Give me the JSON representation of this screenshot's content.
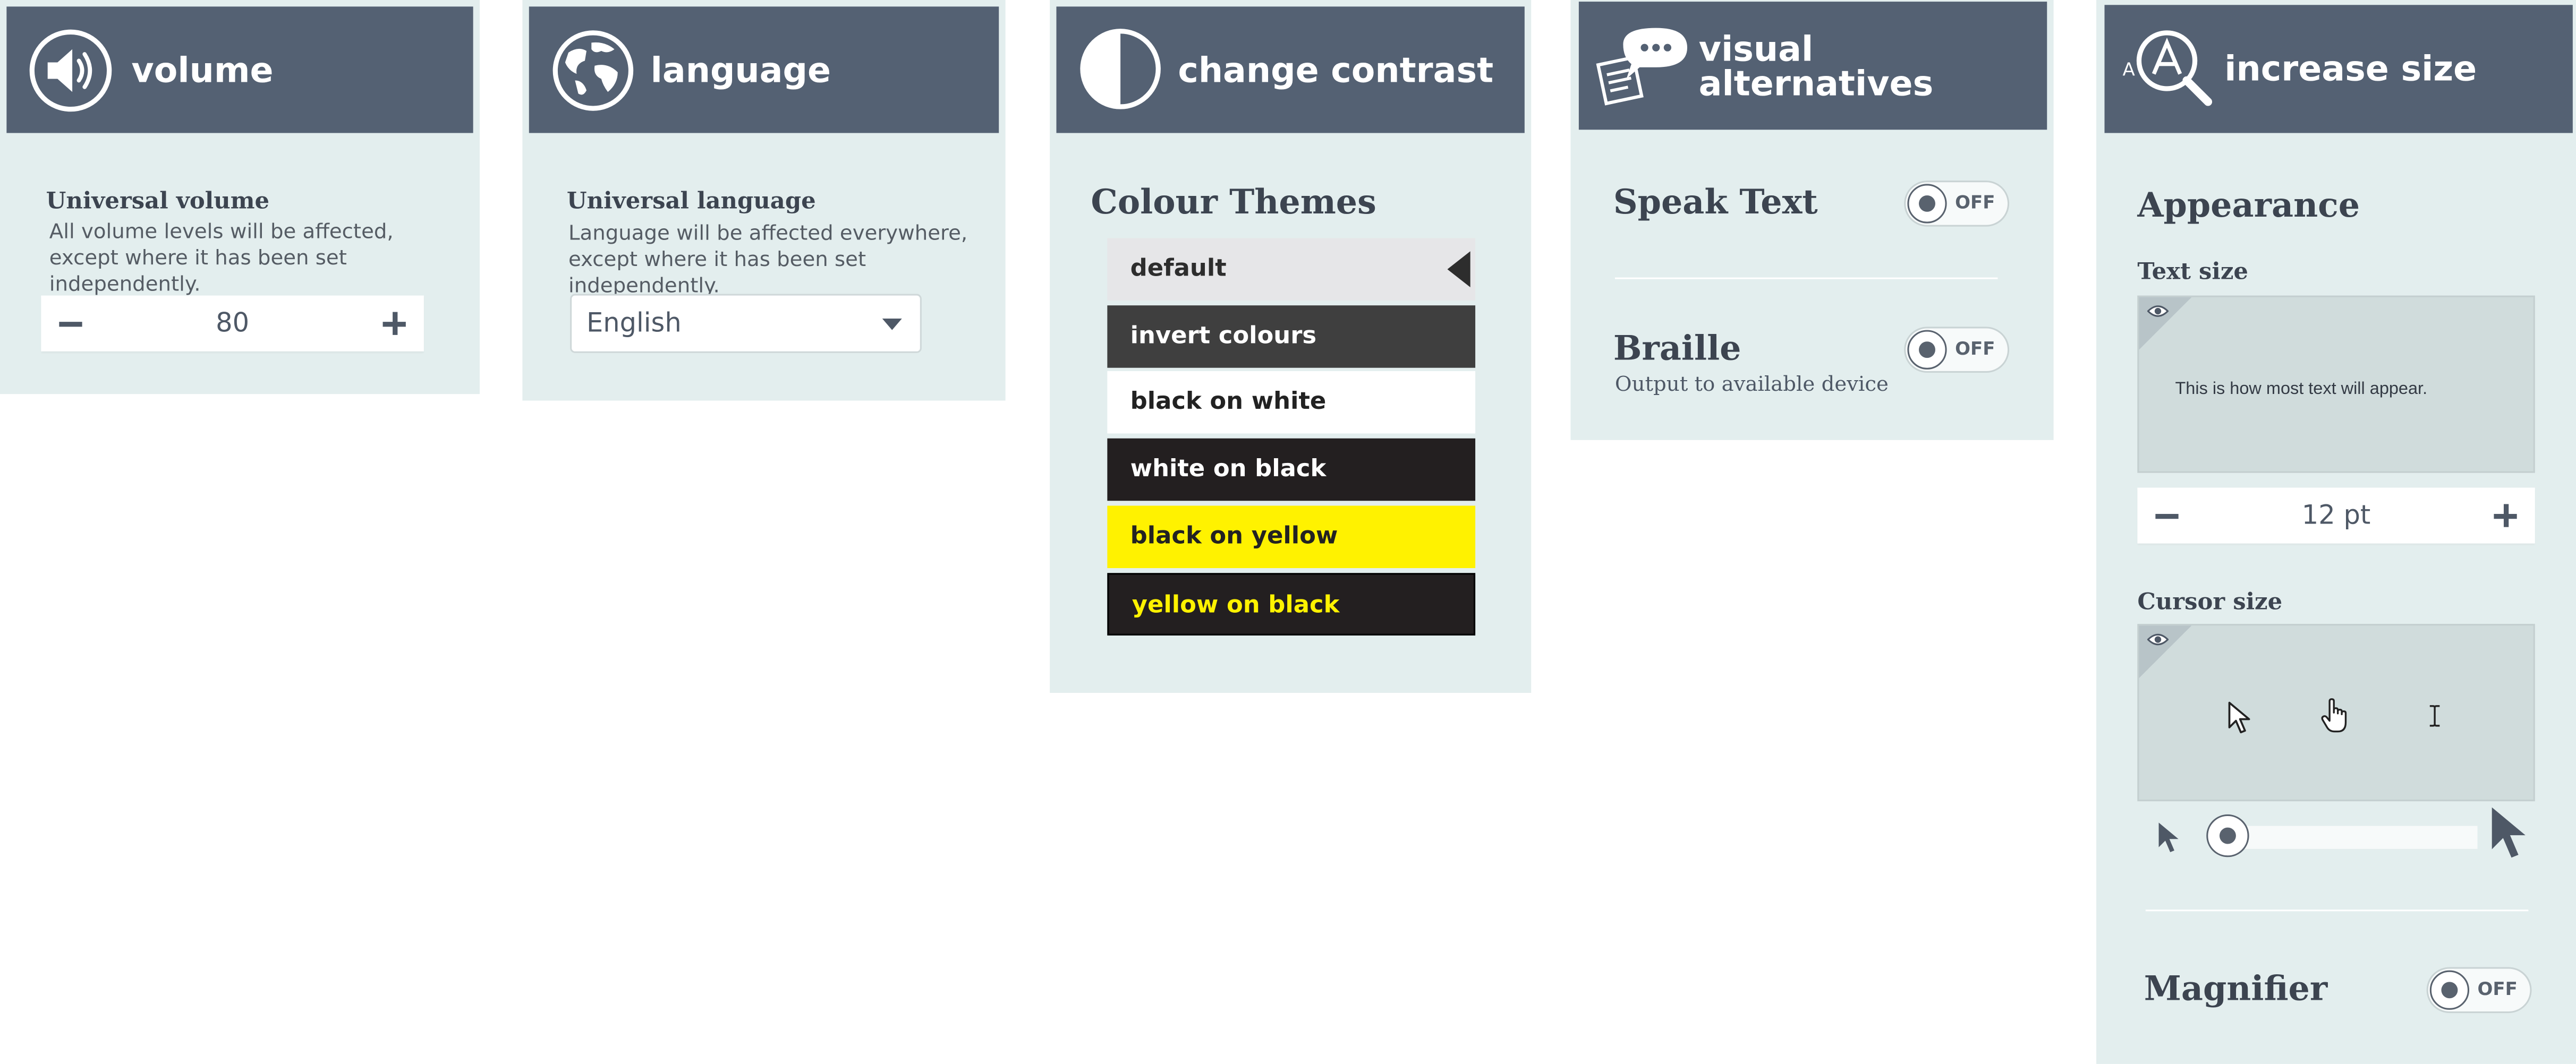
{
  "volume": {
    "title": "volume",
    "heading": "Universal volume",
    "description": "All volume levels will be affected, except where it has been set independently.",
    "value": "80"
  },
  "language": {
    "title": "language",
    "heading": "Universal language",
    "description": "Language will be affected everywhere, except where it has been set independently.",
    "selected": "English"
  },
  "contrast": {
    "title": "change contrast",
    "heading": "Colour Themes",
    "themes": [
      {
        "label": "default",
        "bg": "#e6e6e8",
        "fg": "#2d2d2d",
        "selected": true
      },
      {
        "label": "invert colours",
        "bg": "#3f3f3f",
        "fg": "#ffffff"
      },
      {
        "label": "black on white",
        "bg": "#ffffff",
        "fg": "#222222"
      },
      {
        "label": "white on black",
        "bg": "#231f20",
        "fg": "#ffffff"
      },
      {
        "label": "black on yellow",
        "bg": "#fff200",
        "fg": "#222222"
      },
      {
        "label": "yellow on black",
        "bg": "#231f20",
        "fg": "#fff200"
      }
    ]
  },
  "visual": {
    "title_line1": "visual",
    "title_line2": "alternatives",
    "speak_text": {
      "label": "Speak Text",
      "toggle": "OFF"
    },
    "braille": {
      "label": "Braille",
      "sublabel": "Output to available device",
      "toggle": "OFF"
    }
  },
  "increase": {
    "title": "increase size",
    "icon_letter": "A",
    "heading": "Appearance",
    "text_size": {
      "label": "Text size",
      "preview": "This is how most text will appear.",
      "value": "12 pt"
    },
    "cursor_size": {
      "label": "Cursor size",
      "slider_level": 0.05
    },
    "magnifier": {
      "label": "Magnifier",
      "toggle": "OFF"
    }
  },
  "colors": {
    "header": "#546173",
    "panel": "#e3eeee",
    "text_dark": "#3c4450"
  },
  "icons": [
    "speaker-icon",
    "globe-icon",
    "contrast-icon",
    "speech-bubble-icon",
    "magnifier-icon",
    "eye-icon",
    "arrow-cursor-icon",
    "hand-cursor-icon",
    "text-cursor-icon"
  ]
}
